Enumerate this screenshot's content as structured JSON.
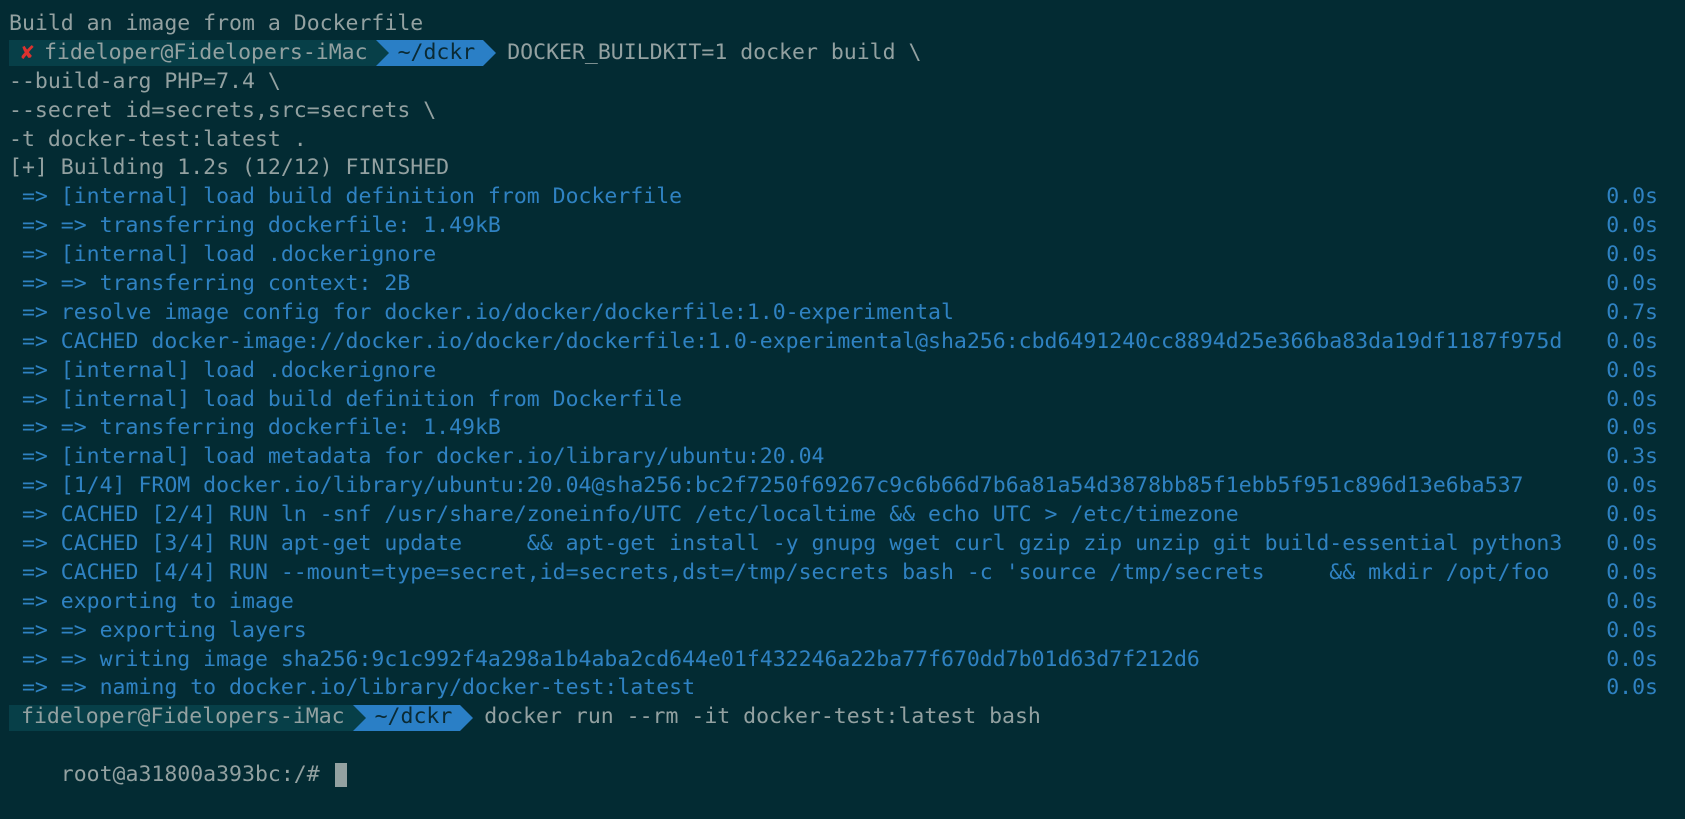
{
  "heading": "Build an image from a Dockerfile",
  "prompt1": {
    "status_icon": "✘",
    "user_host": "fideloper@Fidelopers-iMac",
    "dir": "~/dckr",
    "command": "DOCKER_BUILDKIT=1 docker build \\"
  },
  "continuations": [
    "--build-arg PHP=7.4 \\",
    "--secret id=secrets,src=secrets \\",
    "-t docker-test:latest ."
  ],
  "build_header": "[+] Building 1.2s (12/12) FINISHED",
  "steps": [
    {
      "text": " => [internal] load build definition from Dockerfile",
      "time": "0.0s"
    },
    {
      "text": " => => transferring dockerfile: 1.49kB",
      "time": "0.0s"
    },
    {
      "text": " => [internal] load .dockerignore",
      "time": "0.0s"
    },
    {
      "text": " => => transferring context: 2B",
      "time": "0.0s"
    },
    {
      "text": " => resolve image config for docker.io/docker/dockerfile:1.0-experimental",
      "time": "0.7s"
    },
    {
      "text": " => CACHED docker-image://docker.io/docker/dockerfile:1.0-experimental@sha256:cbd6491240cc8894d25e366ba83da19df1187f975d",
      "time": "0.0s"
    },
    {
      "text": " => [internal] load .dockerignore",
      "time": "0.0s"
    },
    {
      "text": " => [internal] load build definition from Dockerfile",
      "time": "0.0s"
    },
    {
      "text": " => => transferring dockerfile: 1.49kB",
      "time": "0.0s"
    },
    {
      "text": " => [internal] load metadata for docker.io/library/ubuntu:20.04",
      "time": "0.3s"
    },
    {
      "text": " => [1/4] FROM docker.io/library/ubuntu:20.04@sha256:bc2f7250f69267c9c6b66d7b6a81a54d3878bb85f1ebb5f951c896d13e6ba537",
      "time": "0.0s"
    },
    {
      "text": " => CACHED [2/4] RUN ln -snf /usr/share/zoneinfo/UTC /etc/localtime && echo UTC > /etc/timezone",
      "time": "0.0s"
    },
    {
      "text": " => CACHED [3/4] RUN apt-get update     && apt-get install -y gnupg wget curl gzip zip unzip git build-essential python3",
      "time": "0.0s"
    },
    {
      "text": " => CACHED [4/4] RUN --mount=type=secret,id=secrets,dst=/tmp/secrets bash -c 'source /tmp/secrets     && mkdir /opt/foo",
      "time": "0.0s"
    },
    {
      "text": " => exporting to image",
      "time": "0.0s"
    },
    {
      "text": " => => exporting layers",
      "time": "0.0s"
    },
    {
      "text": " => => writing image sha256:9c1c992f4a298a1b4aba2cd644e01f432246a22ba77f670dd7b01d63d7f212d6",
      "time": "0.0s"
    },
    {
      "text": " => => naming to docker.io/library/docker-test:latest",
      "time": "0.0s"
    }
  ],
  "prompt2": {
    "user_host": "fideloper@Fidelopers-iMac",
    "dir": "~/dckr",
    "command": "docker run --rm -it docker-test:latest bash"
  },
  "root_prompt": "root@a31800a393bc:/# ",
  "colors": {
    "background": "#032b33",
    "text": "#93a1a1",
    "output_blue": "#2f82c2",
    "dir_segment": "#2a7fc6",
    "user_segment": "#073f48",
    "error_cross": "#dc322f"
  }
}
